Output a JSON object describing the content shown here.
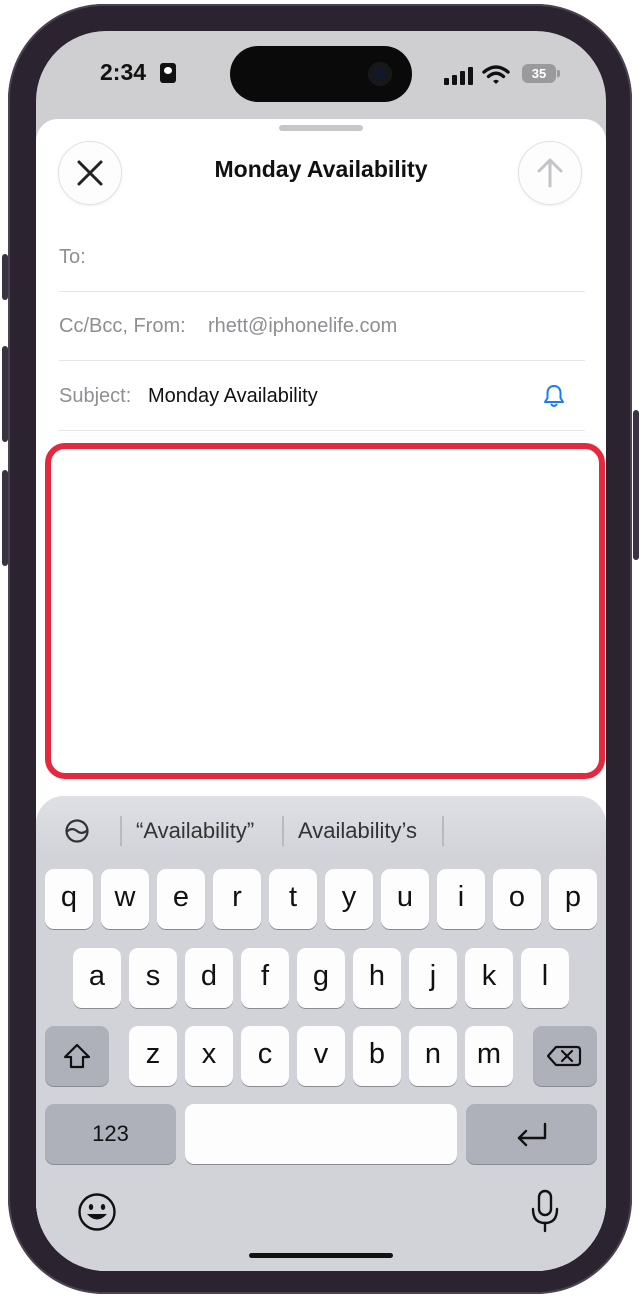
{
  "status": {
    "time": "2:34",
    "battery": "35"
  },
  "compose": {
    "title": "Monday Availability",
    "to_label": "To:",
    "cc_label": "Cc/Bcc, From:",
    "from_value": "rhett@iphonelife.com",
    "subject_label": "Subject:",
    "subject_value": "Monday Availability",
    "icons": {
      "close": "close-icon",
      "send": "arrow-up-icon",
      "notify": "bell-icon"
    },
    "body_highlight_color": "#e5283f"
  },
  "keyboard": {
    "suggestions": [
      "“Availability”",
      "Availability’s"
    ],
    "row1": [
      "q",
      "w",
      "e",
      "r",
      "t",
      "y",
      "u",
      "i",
      "o",
      "p"
    ],
    "row2": [
      "a",
      "s",
      "d",
      "f",
      "g",
      "h",
      "j",
      "k",
      "l"
    ],
    "row3": [
      "z",
      "x",
      "c",
      "v",
      "b",
      "n",
      "m"
    ],
    "numbers_label": "123",
    "icons": [
      "emoji-shape-icon",
      "shift-icon",
      "delete-icon",
      "return-icon",
      "emoji-icon",
      "microphone-icon"
    ]
  }
}
